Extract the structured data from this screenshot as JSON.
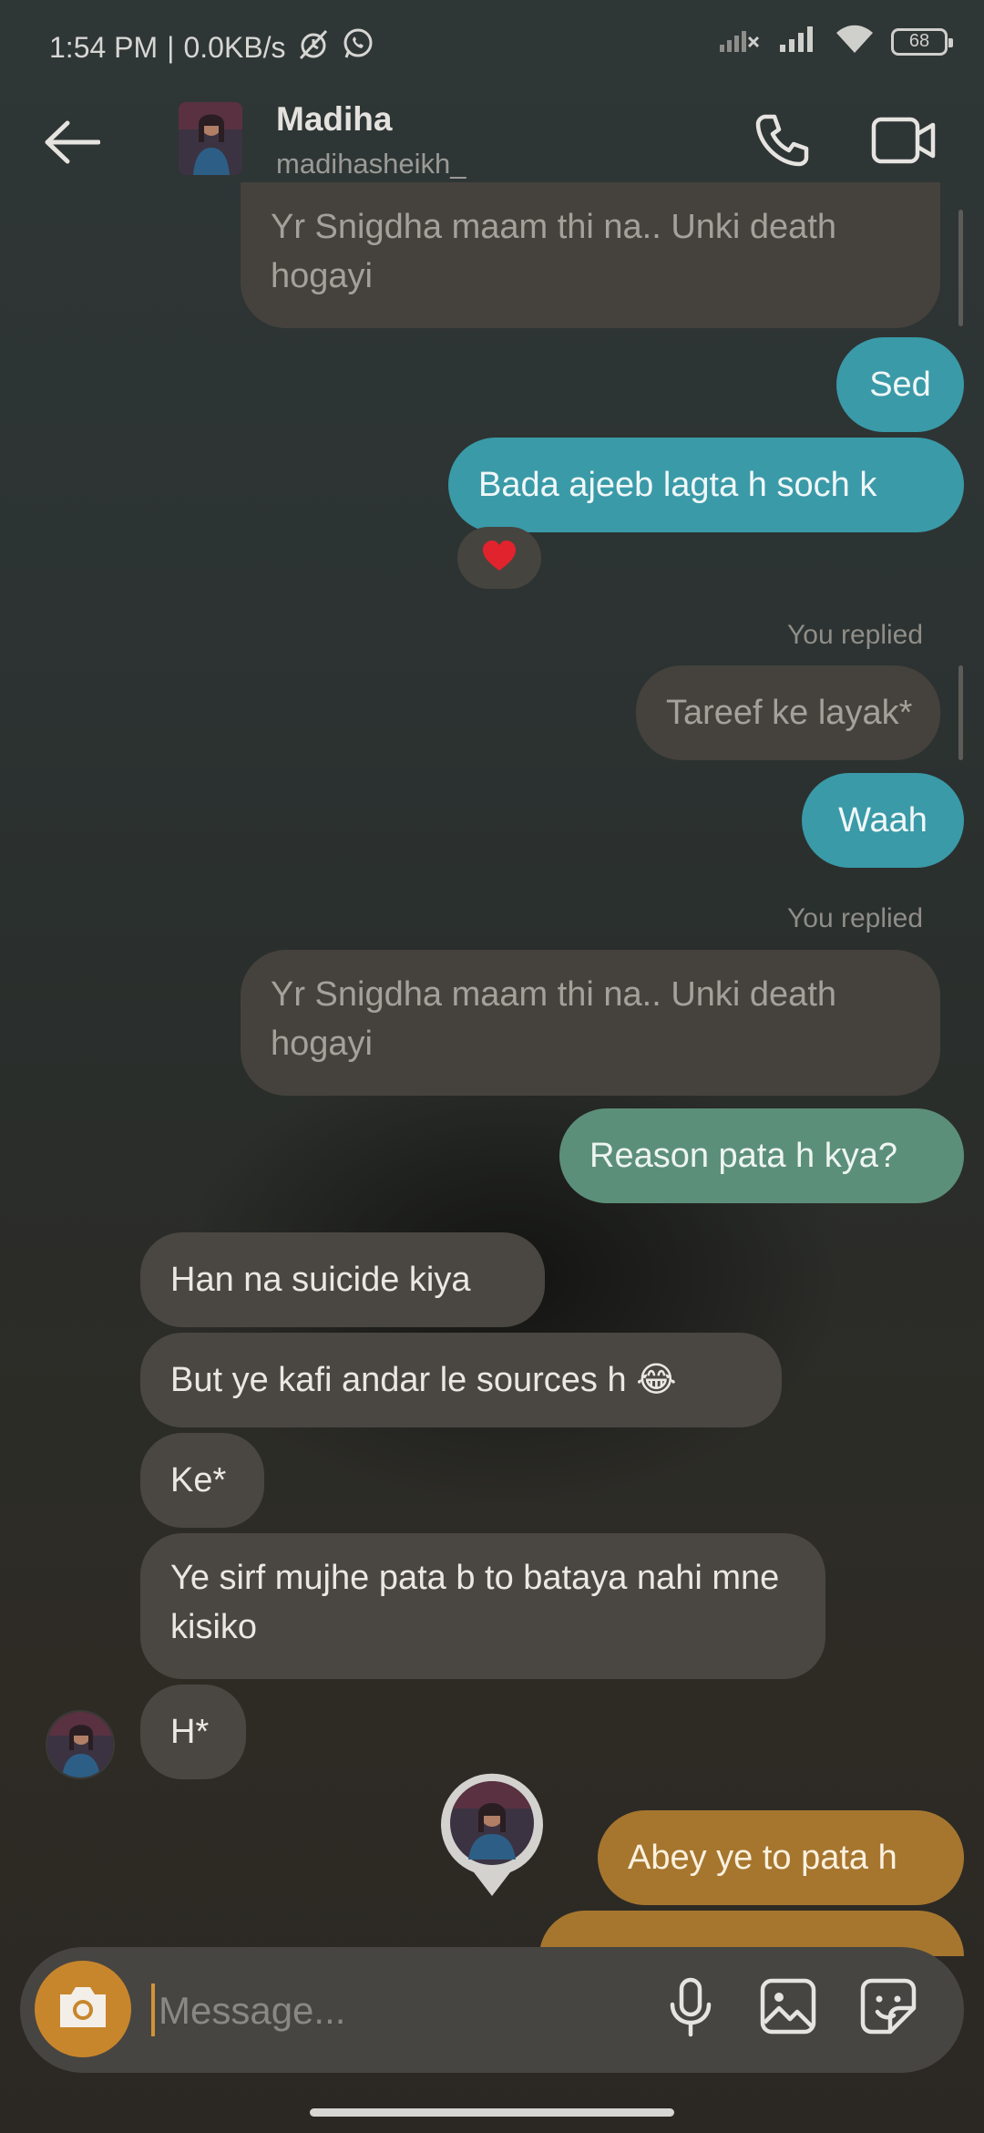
{
  "status_bar": {
    "time": "1:54 PM",
    "speed": "0.0KB/s",
    "separator": "|",
    "battery": "68",
    "icons": [
      "alarm-off-icon",
      "whatsapp-icon",
      "signal-off-icon",
      "signal-icon",
      "wifi-icon",
      "battery-icon"
    ]
  },
  "header": {
    "name": "Madiha",
    "username": "madihasheikh_",
    "icons": [
      "back-arrow-icon",
      "phone-icon",
      "video-camera-icon"
    ]
  },
  "messages": {
    "m1_reply": "Yr Snigdha maam thi na.. Unki death hogayi",
    "m2": "Sed",
    "m3": "Bada ajeeb lagta h soch k",
    "m3_reaction": "❤️",
    "you_replied_1": "You replied",
    "m4_reply": "Tareef ke layak*",
    "m5": "Waah",
    "you_replied_2": "You replied",
    "m6_reply": "Yr Snigdha maam thi na.. Unki death hogayi",
    "m7": "Reason pata h kya?",
    "m8": "Han na suicide kiya",
    "m9": "But ye kafi andar le sources h 😂",
    "m10": "Ke*",
    "m11": "Ye sirf mujhe pata b to bataya nahi mne kisiko",
    "m12": "H*",
    "m13": "Abey ye to pata h"
  },
  "composer": {
    "placeholder": "Message...",
    "icons": [
      "camera-icon",
      "microphone-icon",
      "gallery-icon",
      "sticker-icon"
    ]
  },
  "colors": {
    "teal_bubble": "#3a9aa8",
    "green_bubble": "#5c8f79",
    "orange_bubble": "#a6762f",
    "received_bubble": "#4a4742",
    "camera_button": "#c8862c"
  }
}
